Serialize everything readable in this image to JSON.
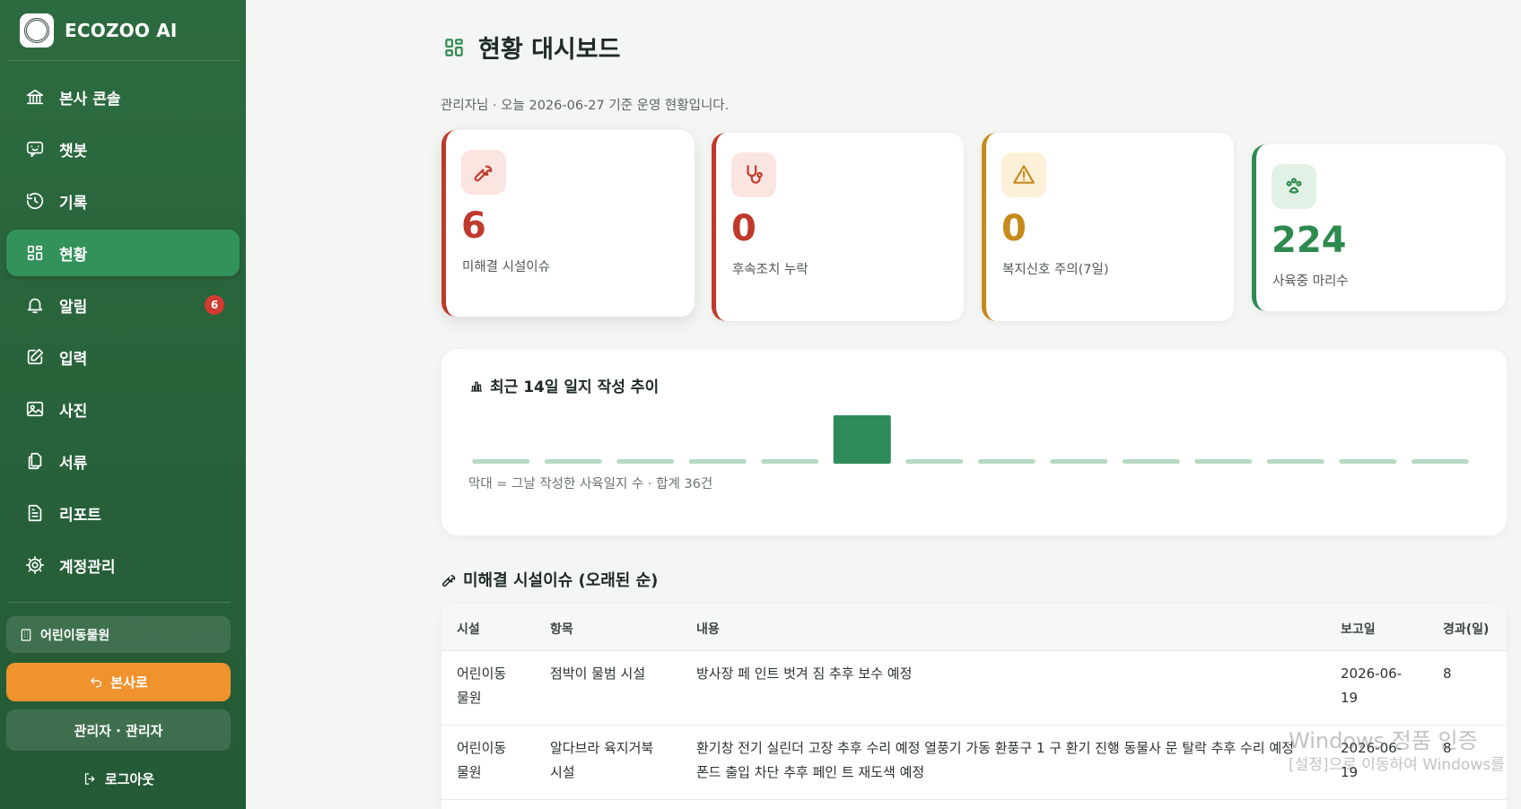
{
  "app": {
    "brand_name": "ECOZOO AI"
  },
  "sidebar": {
    "items": [
      {
        "label": "본사 콘솔",
        "icon": "bank-icon"
      },
      {
        "label": "챗봇",
        "icon": "chat-icon"
      },
      {
        "label": "기록",
        "icon": "history-icon"
      },
      {
        "label": "현황",
        "icon": "dashboard-icon",
        "active": true
      },
      {
        "label": "알림",
        "icon": "bell-icon",
        "badge": "6"
      },
      {
        "label": "입력",
        "icon": "edit-icon"
      },
      {
        "label": "사진",
        "icon": "image-icon"
      },
      {
        "label": "서류",
        "icon": "files-icon"
      },
      {
        "label": "리포트",
        "icon": "report-icon"
      },
      {
        "label": "계정관리",
        "icon": "gear-icon"
      }
    ],
    "zoo_name": "어린이동물원",
    "hq_button": "본사로",
    "admin_label": "관리자 · 관리자",
    "logout": "로그아웃"
  },
  "header": {
    "title": "현황 대시보드",
    "subtitle": "관리자님 · 오늘 2026-06-27 기준 운영 현황입니다."
  },
  "stats": [
    {
      "value": "6",
      "label": "미해결 시설이슈",
      "icon": "wrench-icon",
      "color": "#c0392b",
      "icon_bg": "#fbe5e1"
    },
    {
      "value": "0",
      "label": "후속조치 누락",
      "icon": "stethoscope-icon",
      "color": "#c0392b",
      "icon_bg": "#fbe5e1"
    },
    {
      "value": "0",
      "label": "복지신호 주의(7일)",
      "icon": "warning-icon",
      "color": "#c58a1c",
      "icon_bg": "#fdf0d8"
    },
    {
      "value": "224",
      "label": "사육중 마리수",
      "icon": "paw-icon",
      "color": "#2e8a4f",
      "icon_bg": "#e2f1e6"
    }
  ],
  "chart": {
    "title": "최근 14일 일지 작성 추이",
    "caption": "막대 = 그날 작성한 사육일지 수 · 합계 36건"
  },
  "chart_data": {
    "type": "bar",
    "categories": [
      "",
      "",
      "",
      "",
      "",
      "",
      "",
      "",
      "",
      "",
      "",
      "",
      "",
      ""
    ],
    "values": [
      0,
      0,
      0,
      0,
      0,
      36,
      0,
      0,
      0,
      0,
      0,
      0,
      0,
      0
    ],
    "title": "최근 14일 일지 작성 추이",
    "xlabel": "",
    "ylabel": "",
    "ylim": [
      0,
      36
    ],
    "grid": false,
    "colors": {
      "bar": "#2e8b57",
      "empty": "#b7d9c3"
    }
  },
  "issues": {
    "title": "미해결 시설이슈 (오래된 순)",
    "columns": [
      "시설",
      "항목",
      "내용",
      "보고일",
      "경과(일)"
    ],
    "rows": [
      {
        "facility": "어린이동\n물원",
        "item": "점박이 물범 시설",
        "content": "방사장 페 인트 벗겨 짐 추후 보수 예정",
        "date": "2026-06-\n19",
        "elapsed": "8"
      },
      {
        "facility": "어린이동\n물원",
        "item": "알다브라 육지거북\n시설",
        "content": "환기창 전기 실린더 고장 추후 수리 예정 열풍기 가동 환풍구 1 구 환기 진행 동물사 문 탈락 추후 수리 예정\n폰드 출입 차단 추후 페인 트 재도색 예정",
        "date": "2026-06-\n19",
        "elapsed": "8"
      }
    ]
  },
  "watermark": {
    "line1": "Windows 정품 인증",
    "line2": "[설정]으로 이동하여 Windows를"
  }
}
